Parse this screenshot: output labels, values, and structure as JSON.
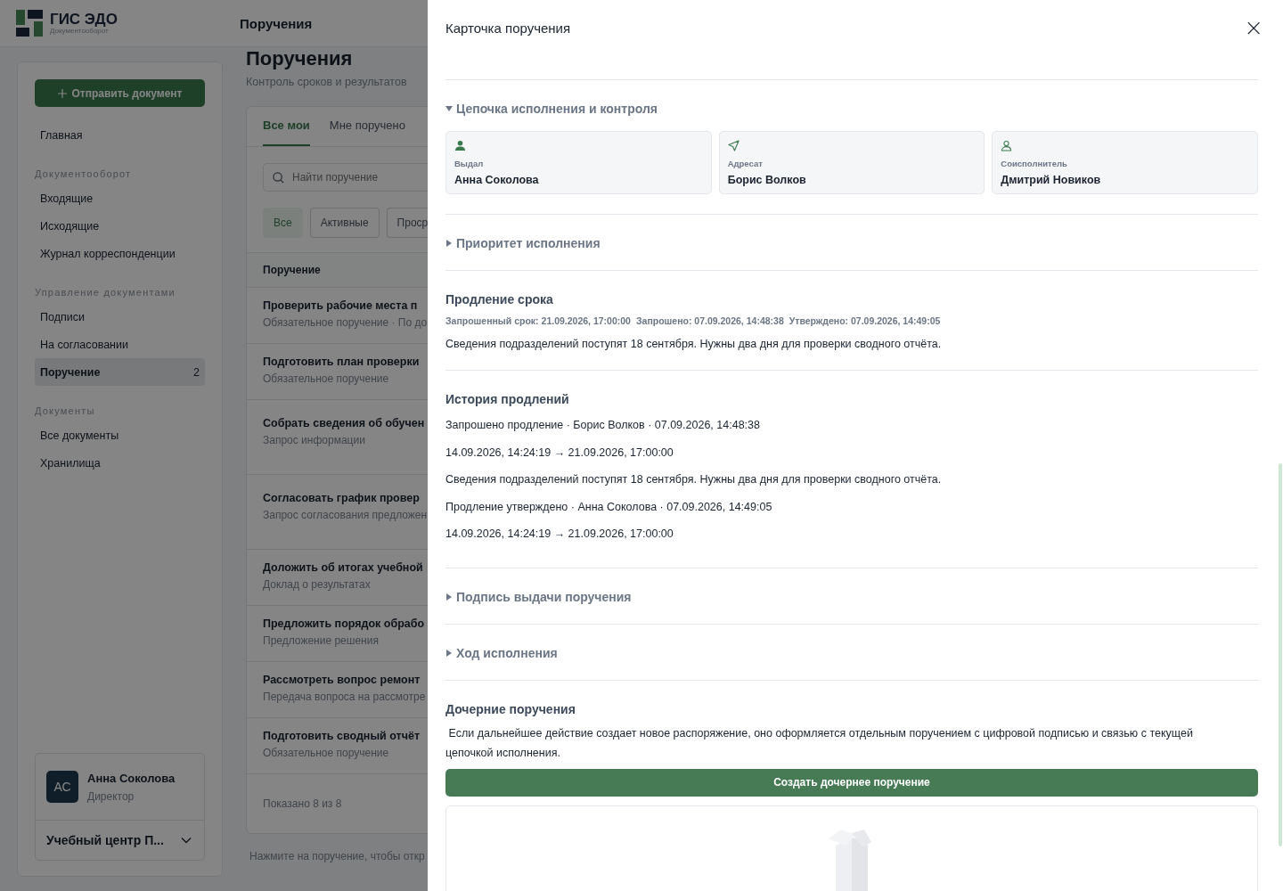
{
  "app": {
    "logo_title": "ГИС ЭДО",
    "logo_subtitle": "Документооборот",
    "header_title": "Поручения"
  },
  "sidebar": {
    "send_button": "Отправить документ",
    "groups": [
      {
        "items": [
          {
            "label": "Главная",
            "selected": false
          }
        ]
      },
      {
        "label": "Документооборот",
        "items": [
          {
            "label": "Входящие",
            "selected": false
          },
          {
            "label": "Исходящие",
            "selected": false
          },
          {
            "label": "Журнал корреспонденции",
            "selected": false
          }
        ]
      },
      {
        "label": "Управление документами",
        "items": [
          {
            "label": "Подписи",
            "selected": false
          },
          {
            "label": "На согласовании",
            "selected": false
          },
          {
            "label": "Поручение",
            "selected": true,
            "badge": "2"
          }
        ]
      },
      {
        "label": "Документы",
        "items": [
          {
            "label": "Все документы",
            "selected": false
          },
          {
            "label": "Хранилища",
            "selected": false
          }
        ]
      }
    ],
    "user": {
      "initials": "АС",
      "name": "Анна Соколова",
      "role": "Директор"
    },
    "org": "Учебный центр П..."
  },
  "page": {
    "title": "Поручения",
    "subtitle": "Контроль сроков и результатов",
    "tabs": [
      {
        "label": "Все мои",
        "selected": true
      },
      {
        "label": "Мне поручено",
        "selected": false
      }
    ],
    "search": {
      "placeholder": "Найти поручение"
    },
    "filters": [
      {
        "label": "Все",
        "selected": true
      },
      {
        "label": "Активные",
        "selected": false
      },
      {
        "label": "Проср",
        "selected": false
      }
    ],
    "table": {
      "column": "Поручение",
      "rows": [
        {
          "title": "Проверить рабочие места п",
          "subtitle": "Обязательное поручение · По до"
        },
        {
          "title": "Подготовить план проверки",
          "subtitle": "Обязательное поручение"
        },
        {
          "title": "Собрать сведения об обучен",
          "subtitle": "Запрос информации"
        },
        {
          "title": "Согласовать график провер",
          "subtitle": "Запрос согласования предложен"
        },
        {
          "title": "Доложить об итогах учебной",
          "subtitle": "Доклад о результатах"
        },
        {
          "title": "Предложить порядок обрабо",
          "subtitle": "Предложение решения"
        },
        {
          "title": "Рассмотреть вопрос ремонт",
          "subtitle": "Передача вопроса на рассмотре"
        },
        {
          "title": "Подготовить сводный отчёт",
          "subtitle": "Обязательное поручение"
        }
      ],
      "footer": "Показано 8 из 8"
    },
    "hint": "Нажмите на поручение, чтобы откр"
  },
  "drawer": {
    "title": "Карточка поручения",
    "close": "×",
    "sections": [
      {
        "kind": "collapsible",
        "title": "Цепочка исполнения и контроля",
        "expanded": true,
        "cards": [
          {
            "role": "Выдал",
            "name": "Анна Соколова"
          },
          {
            "role": "Адресат",
            "name": "Борис Волков"
          },
          {
            "role": "Соисполнитель",
            "name": "Дмитрий Новиков"
          }
        ]
      },
      {
        "kind": "collapsible",
        "title": "Приоритет исполнения",
        "expanded": false
      },
      {
        "kind": "block",
        "title": "Продление срока",
        "meta": [
          "Запрошенный срок: 21.09.2026, 17:00:00",
          "Запрошено: 07.09.2026, 14:48:38",
          "Утверждено: 07.09.2026, 14:49:05"
        ],
        "lines": [
          "Сведения подразделений поступят 18 сентября. Нужны два дня для проверки сводного отчёта."
        ]
      },
      {
        "kind": "block",
        "title": "История продлений",
        "lines": [
          "Запрошено продление · Борис Волков · 07.09.2026, 14:48:38",
          "14.09.2026, 14:24:19 → 21.09.2026, 17:00:00",
          "Сведения подразделений поступят 18 сентября. Нужны два дня для проверки сводного отчёта.",
          "Продление утверждено · Анна Соколова · 07.09.2026, 14:49:05",
          "14.09.2026, 14:24:19 → 21.09.2026, 17:00:00"
        ]
      },
      {
        "kind": "collapsible",
        "title": "Подпись выдачи поручения",
        "expanded": false
      },
      {
        "kind": "collapsible",
        "title": "Ход исполнения",
        "expanded": false
      },
      {
        "kind": "children",
        "title": "Дочерние поручения",
        "text": " Если дальнейшее действие создает новое распоряжение, оно оформляется отдельным поручением с цифровой подписью и связью с текущей цепочкой исполнения.",
        "button": "Создать дочернее поручение"
      }
    ]
  }
}
